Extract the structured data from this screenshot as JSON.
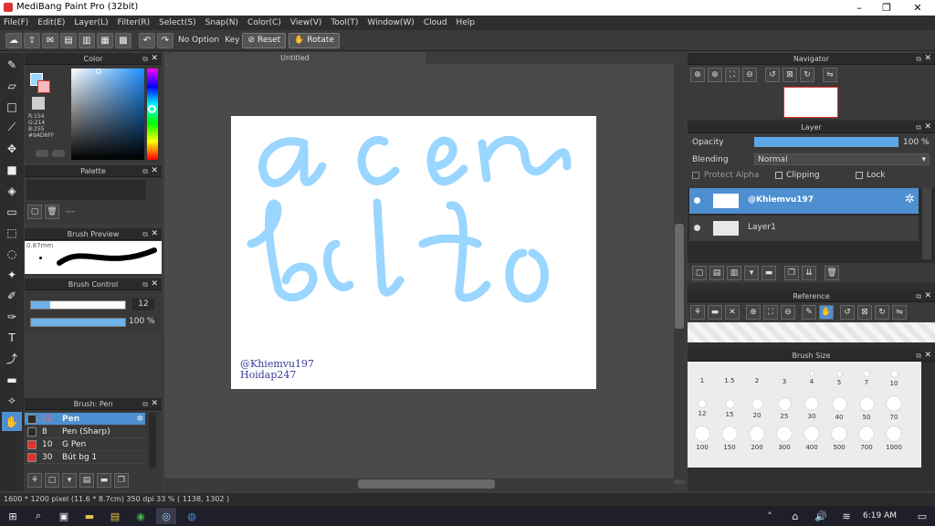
{
  "window": {
    "title": "MediBang Paint Pro (32bit)"
  },
  "menu": [
    "File(F)",
    "Edit(E)",
    "Layer(L)",
    "Filter(R)",
    "Select(S)",
    "Snap(N)",
    "Color(C)",
    "View(V)",
    "Tool(T)",
    "Window(W)",
    "Cloud",
    "Help"
  ],
  "toolbar": {
    "no_option": "No Option",
    "key": "Key",
    "reset": "Reset",
    "rotate": "Rotate"
  },
  "color_panel": {
    "title": "Color",
    "r": "R:154",
    "g": "G:214",
    "b": "B:255",
    "hex": "#9AD6FF",
    "fg": "#9AD6FF"
  },
  "palette_panel": {
    "title": "Palette",
    "value": "---"
  },
  "brush_preview": {
    "title": "Brush Preview",
    "size": "0.87mm"
  },
  "brush_control": {
    "title": "Brush Control",
    "size": "12",
    "opacity": "100 %",
    "size_fraction": 0.2,
    "opacity_fraction": 1.0
  },
  "brush_list": {
    "title": "Brush: Pen",
    "items": [
      {
        "size": "12",
        "name": "Pen",
        "color": "#2a2a2a",
        "selected": true
      },
      {
        "size": "8",
        "name": "Pen (Sharp)",
        "color": "#2a2a2a",
        "selected": false
      },
      {
        "size": "10",
        "name": "G Pen",
        "color": "#e0322b",
        "selected": false
      },
      {
        "size": "30",
        "name": "Bút bg 1",
        "color": "#e0322b",
        "selected": false
      }
    ]
  },
  "document": {
    "tab": "Untitled",
    "watermark1": "@Khiemvu197",
    "watermark2": "Hoidap247"
  },
  "navigator": {
    "title": "Navigator"
  },
  "layer_panel": {
    "title": "Layer",
    "opacity_label": "Opacity",
    "opacity_value": "100 %",
    "blending_label": "Blending",
    "blending_value": "Normal",
    "protect_alpha": "Protect Alpha",
    "clipping": "Clipping",
    "lock": "Lock",
    "layers": [
      {
        "name": "@Khiemvu197",
        "selected": true
      },
      {
        "name": "Layer1",
        "selected": false
      }
    ]
  },
  "reference": {
    "title": "Reference"
  },
  "brush_size": {
    "title": "Brush Size",
    "rows": [
      [
        "1",
        "1.5",
        "2",
        "3",
        "4",
        "5",
        "7",
        "10"
      ],
      [
        "12",
        "15",
        "20",
        "25",
        "30",
        "40",
        "50",
        "70"
      ],
      [
        "100",
        "150",
        "200",
        "300",
        "400",
        "500",
        "700",
        "1000"
      ]
    ]
  },
  "status": "1600 * 1200 pixel  (11.6 * 8.7cm)  350 dpi  33 %  ( 1138, 1302 )",
  "taskbar": {
    "time": "6:19 AM"
  },
  "colors": {
    "accent": "#4d8fd1",
    "stroke": "#9AD6FF"
  }
}
